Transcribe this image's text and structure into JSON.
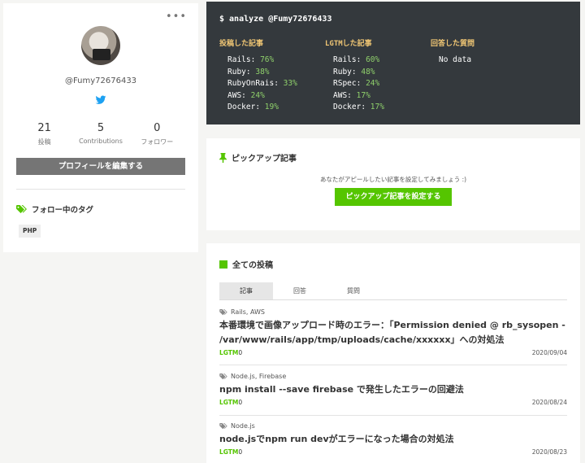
{
  "profile": {
    "more_label": "•••",
    "username": "@Fumy72676433",
    "stats": [
      {
        "num": "21",
        "label": "投稿"
      },
      {
        "num": "5",
        "label": "Contributions"
      },
      {
        "num": "0",
        "label": "フォロワー"
      }
    ],
    "edit_button": "プロフィールを編集する",
    "tags_heading": "フォロー中のタグ",
    "tags": [
      "PHP"
    ]
  },
  "terminal": {
    "command": "$ analyze @Fumy72676433",
    "columns": [
      {
        "title": "投稿した記事",
        "rows": [
          {
            "name": "Rails:",
            "value": "76%"
          },
          {
            "name": "Ruby:",
            "value": "38%"
          },
          {
            "name": "RubyOnRais:",
            "value": "33%"
          },
          {
            "name": "AWS:",
            "value": "24%"
          },
          {
            "name": "Docker:",
            "value": "19%"
          }
        ]
      },
      {
        "title": "LGTMした記事",
        "rows": [
          {
            "name": "Rails:",
            "value": "60%"
          },
          {
            "name": "Ruby:",
            "value": "48%"
          },
          {
            "name": "RSpec:",
            "value": "24%"
          },
          {
            "name": "AWS:",
            "value": "17%"
          },
          {
            "name": "Docker:",
            "value": "17%"
          }
        ]
      },
      {
        "title": "回答した質問",
        "rows": [
          {
            "name": "No data",
            "value": ""
          }
        ]
      }
    ]
  },
  "pickup": {
    "title": "ピックアップ記事",
    "description": "あなたがアピールしたい記事を設定してみましょう :)",
    "button": "ピックアップ記事を設定する"
  },
  "posts": {
    "title": "全ての投稿",
    "tabs": [
      "記事",
      "回答",
      "質問"
    ],
    "items": [
      {
        "tags": "Rails, AWS",
        "title": "本番環境で画像アップロード時のエラー：「Permission denied @ rb_sysopen - /var/www/rails/app/tmp/uploads/cache/xxxxxx」への対処法",
        "lgtm_label": "LGTM",
        "lgtm_count": "0",
        "date": "2020/09/04"
      },
      {
        "tags": "Node.js, Firebase",
        "title": "npm install --save firebase で発生したエラーの回避法",
        "lgtm_label": "LGTM",
        "lgtm_count": "0",
        "date": "2020/08/24"
      },
      {
        "tags": "Node.js",
        "title": "node.jsでnpm run devがエラーになった場合の対処法",
        "lgtm_label": "LGTM",
        "lgtm_count": "0",
        "date": "2020/08/23"
      }
    ]
  },
  "colors": {
    "accent": "#55c500",
    "terminal_bg": "#34393d",
    "terminal_heading": "#f0c674",
    "terminal_value": "#8fd06b"
  }
}
